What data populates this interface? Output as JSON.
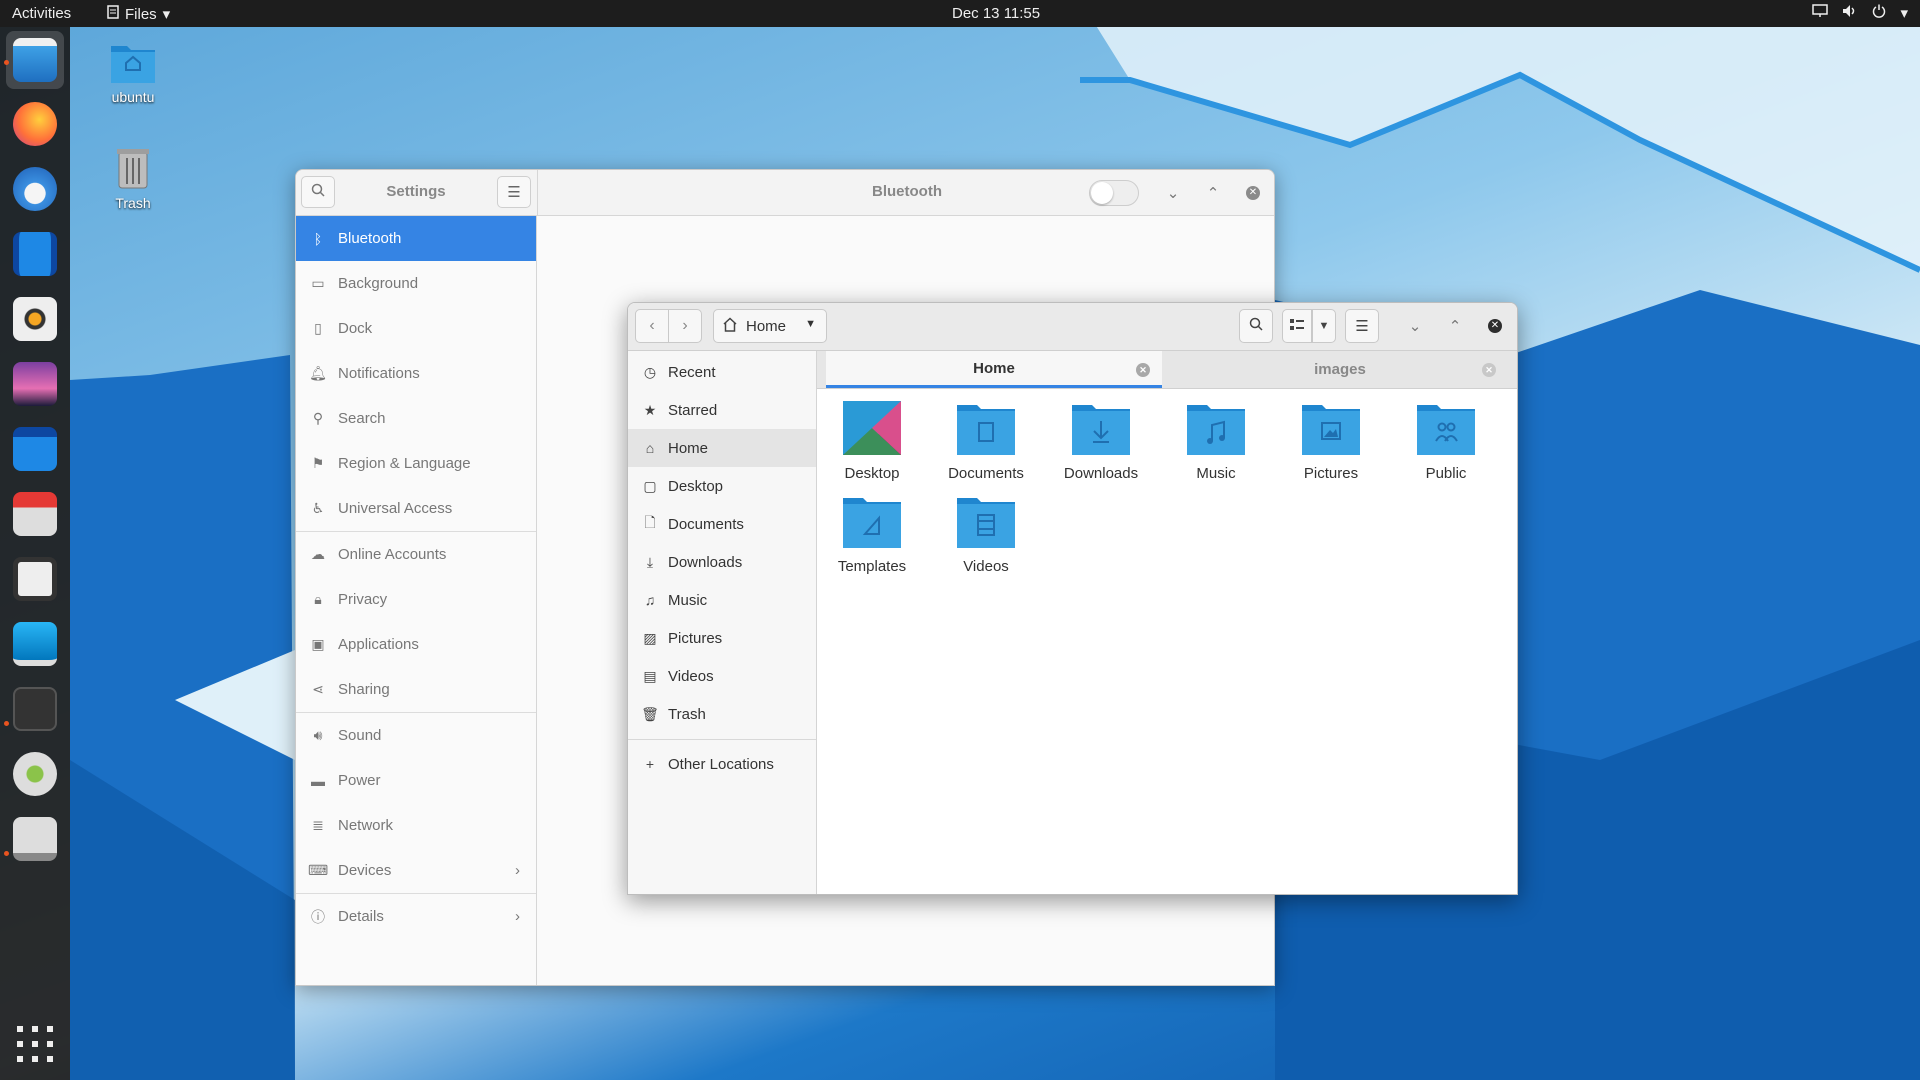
{
  "topbar": {
    "activities": "Activities",
    "app_menu": "Files",
    "clock": "Dec 13  11:55"
  },
  "desktop": {
    "icons": [
      {
        "label": "ubuntu",
        "icon": "home-folder-icon"
      },
      {
        "label": "Trash",
        "icon": "trash-icon"
      }
    ]
  },
  "dock": {
    "apps": [
      "files",
      "firefox",
      "thunderbird",
      "videos",
      "rhythmbox",
      "shotwell",
      "software-center",
      "transmission",
      "screenshot",
      "remote-desktop",
      "settings",
      "gimp",
      "drive"
    ],
    "show_apps": "show-applications-icon"
  },
  "settings": {
    "title": "Settings",
    "panel_title": "Bluetooth",
    "bluetooth_enabled": false,
    "sidebar": [
      {
        "label": "Bluetooth",
        "icon": "bluetooth-icon"
      },
      {
        "label": "Background",
        "icon": "monitor-icon"
      },
      {
        "label": "Dock",
        "icon": "dock-icon"
      },
      {
        "label": "Notifications",
        "icon": "bell-icon"
      },
      {
        "label": "Search",
        "icon": "search-icon"
      },
      {
        "label": "Region & Language",
        "icon": "flag-icon"
      },
      {
        "label": "Universal Access",
        "icon": "accessibility-icon"
      },
      {
        "label": "Online Accounts",
        "icon": "cloud-icon"
      },
      {
        "label": "Privacy",
        "icon": "lock-icon"
      },
      {
        "label": "Applications",
        "icon": "applications-icon"
      },
      {
        "label": "Sharing",
        "icon": "share-icon"
      },
      {
        "label": "Sound",
        "icon": "speaker-icon"
      },
      {
        "label": "Power",
        "icon": "battery-icon"
      },
      {
        "label": "Network",
        "icon": "network-icon"
      },
      {
        "label": "Devices",
        "icon": "devices-icon"
      },
      {
        "label": "Details",
        "icon": "info-icon"
      }
    ]
  },
  "files": {
    "path": "Home",
    "sidebar": [
      {
        "label": "Recent",
        "icon": "clock-icon"
      },
      {
        "label": "Starred",
        "icon": "star-icon"
      },
      {
        "label": "Home",
        "icon": "home-icon"
      },
      {
        "label": "Desktop",
        "icon": "desktop-icon"
      },
      {
        "label": "Documents",
        "icon": "document-icon"
      },
      {
        "label": "Downloads",
        "icon": "download-icon"
      },
      {
        "label": "Music",
        "icon": "music-icon"
      },
      {
        "label": "Pictures",
        "icon": "picture-icon"
      },
      {
        "label": "Videos",
        "icon": "video-icon"
      },
      {
        "label": "Trash",
        "icon": "trash-icon"
      },
      {
        "label": "Other Locations",
        "icon": "plus-icon"
      }
    ],
    "tabs": [
      {
        "label": "Home"
      },
      {
        "label": "images"
      }
    ],
    "folders": [
      {
        "label": "Desktop",
        "icon": "desktop-folder-icon"
      },
      {
        "label": "Documents",
        "icon": "documents-folder-icon"
      },
      {
        "label": "Downloads",
        "icon": "downloads-folder-icon"
      },
      {
        "label": "Music",
        "icon": "music-folder-icon"
      },
      {
        "label": "Pictures",
        "icon": "pictures-folder-icon"
      },
      {
        "label": "Public",
        "icon": "public-folder-icon"
      },
      {
        "label": "Templates",
        "icon": "templates-folder-icon"
      },
      {
        "label": "Videos",
        "icon": "videos-folder-icon"
      }
    ]
  },
  "colors": {
    "accent": "#3584e4",
    "folder": "#2a9ad6",
    "ubuntu_orange": "#e95420"
  }
}
